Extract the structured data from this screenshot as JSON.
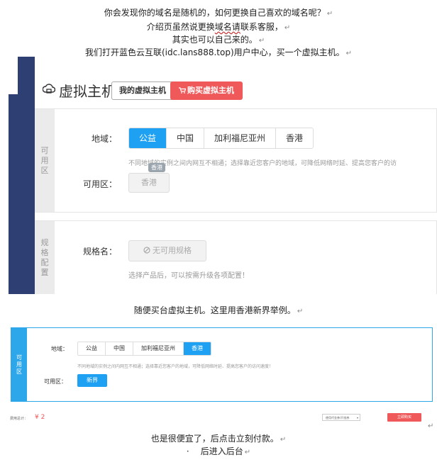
{
  "paragraphs": {
    "line1": "你会发现你的域名是随机的，如何更换自己喜欢的域名呢？",
    "line2_pre": "介绍页虽然说更换",
    "line2_wavy": "域名请",
    "line2_post": "联系客服，",
    "line3": "其实也可以自己来的。",
    "line4": "我们打开蓝色云互联(idc.lans888.top)用户中心，买一个虚拟主机。",
    "caption1": "随便买台虚拟主机。这里用香港新界举例。",
    "caption2": "也是很便宜了，后点击立刻付款。",
    "caption3": "后进入后台",
    "bullet": "·",
    "return_mark": "↵"
  },
  "shot1": {
    "title": "虚拟主机",
    "my_hosts_button": "我的虚拟主机",
    "buy_button": "购买虚拟主机",
    "cart_icon": "cart-icon",
    "zone_tab": "可用区",
    "region_label": "地域：",
    "regions": [
      "公益",
      "中国",
      "加利福尼亚州",
      "香港"
    ],
    "active_region": "公益",
    "hint": "不同地域的实例之间内网互不相通；选择靠近您客户的地域，可降低网络时延、提高您客户的访",
    "tooltip": "香港",
    "zone_label": "可用区：",
    "zone_button": "香港",
    "spec_tab": "规格配置",
    "spec_label": "规格名：",
    "spec_button": "无可用规格",
    "spec_hint": "选择产品后，可以按需升级各项配置！"
  },
  "shot2": {
    "tab": "可用区",
    "region_label": "地域：",
    "regions": [
      "公益",
      "中国",
      "加利福尼亚州",
      "香港"
    ],
    "active_region": "香港",
    "hint": "不同地域的实例之间内网互不相通；选择靠近您客户的地域，可降低网络时延、提高您客户的访问速度！",
    "zone_label": "可用区：",
    "zone_button": "新界"
  },
  "shot3": {
    "total_label": "费用总计：",
    "price": "¥ 2",
    "select_value": "使用代金券/开抵券",
    "pay_button": "立即购买"
  },
  "colors": {
    "sidebar": "#2e3f73",
    "accent": "#1ea0f3",
    "buy": "#f0595a"
  }
}
